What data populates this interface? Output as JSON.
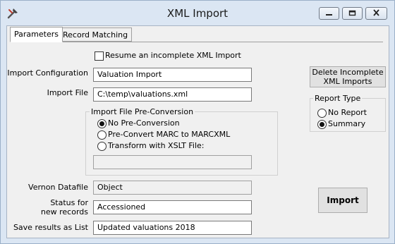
{
  "window": {
    "title": "XML Import"
  },
  "tabs": [
    {
      "label": "Parameters",
      "active": true
    },
    {
      "label": "Record Matching",
      "active": false
    }
  ],
  "form": {
    "resume_label": "Resume an incomplete XML Import",
    "import_config_label": "Import Configuration",
    "import_config_value": "Valuation Import",
    "import_file_label": "Import File",
    "import_file_value": "C:\\temp\\valuations.xml",
    "preconv_title": "Import File Pre-Conversion",
    "preconv_options": [
      {
        "label": "No Pre-Conversion",
        "selected": true
      },
      {
        "label": "Pre-Convert MARC to MARCXML",
        "selected": false
      },
      {
        "label": "Transform with XSLT File:",
        "selected": false
      }
    ],
    "xslt_value": "",
    "datafile_label": "Vernon Datafile",
    "datafile_value": "Object",
    "status_label_line1": "Status for",
    "status_label_line2": "new records",
    "status_value": "Accessioned",
    "save_label": "Save results as List",
    "save_value": "Updated valuations 2018"
  },
  "delete_button": {
    "line1": "Delete Incomplete",
    "line2": "XML Imports"
  },
  "report_type": {
    "title": "Report Type",
    "options": [
      {
        "label": "No Report",
        "selected": false
      },
      {
        "label": "Summary",
        "selected": true
      }
    ]
  },
  "import_button": {
    "label": "Import"
  }
}
